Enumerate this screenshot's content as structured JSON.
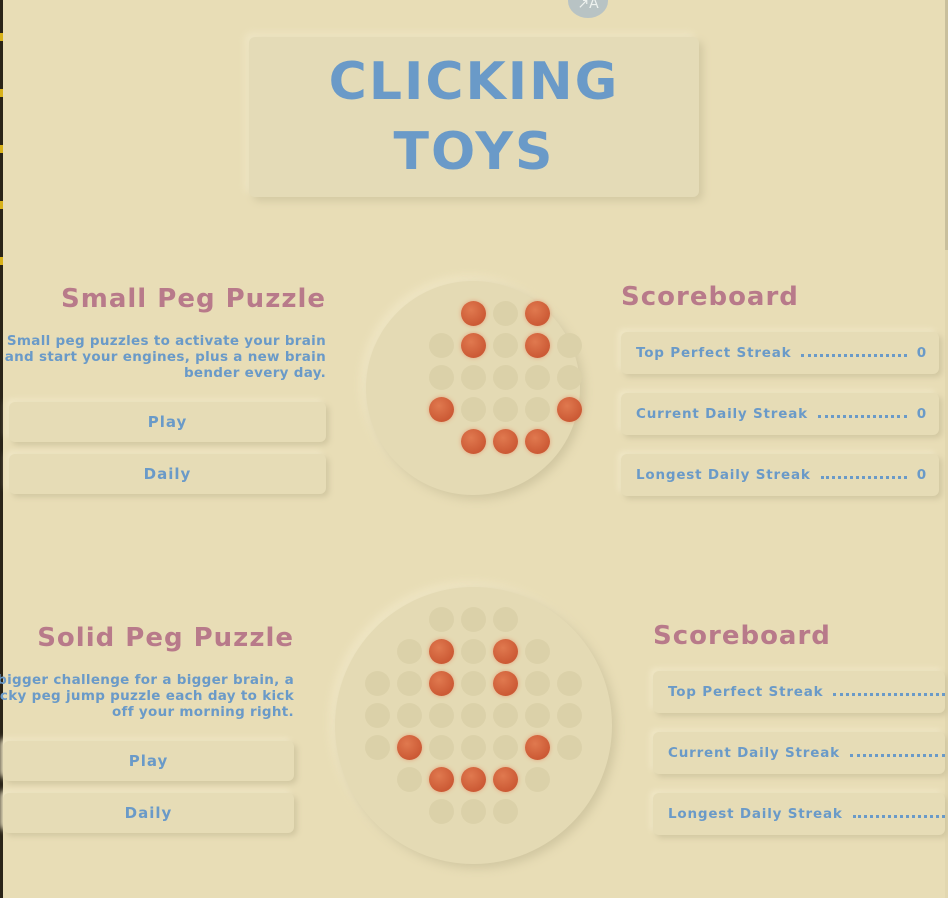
{
  "header": {
    "title_line1": "CLICKING",
    "title_line2": "TOYS",
    "translate_icon": "translate-icon"
  },
  "games": [
    {
      "title": "Small Peg Puzzle",
      "description": [
        "Small peg puzzles to activate your brain",
        "and start your engines, plus a new brain",
        "bender every day."
      ],
      "play_label": "Play",
      "daily_label": "Daily",
      "scoreboard": {
        "title": "Scoreboard",
        "rows": [
          {
            "label": "Top Perfect Streak",
            "value": "0"
          },
          {
            "label": "Current Daily Streak",
            "value": "0"
          },
          {
            "label": "Longest Daily Streak",
            "value": "0"
          }
        ]
      }
    },
    {
      "title": "Solid Peg Puzzle",
      "description": [
        "A bigger challenge for a bigger brain, a",
        "tricky peg jump puzzle each day to kick",
        "off your morning right."
      ],
      "play_label": "Play",
      "daily_label": "Daily",
      "scoreboard": {
        "title": "Scoreboard",
        "rows": [
          {
            "label": "Top Perfect Streak",
            "value": ""
          },
          {
            "label": "Current Daily Streak",
            "value": ""
          },
          {
            "label": "Longest Daily Streak",
            "value": ""
          }
        ]
      }
    }
  ],
  "colors": {
    "background": "#e8ddb6",
    "accent_blue": "#6a9ac8",
    "accent_rose": "#b87a8a",
    "peg": "#d4643c"
  }
}
